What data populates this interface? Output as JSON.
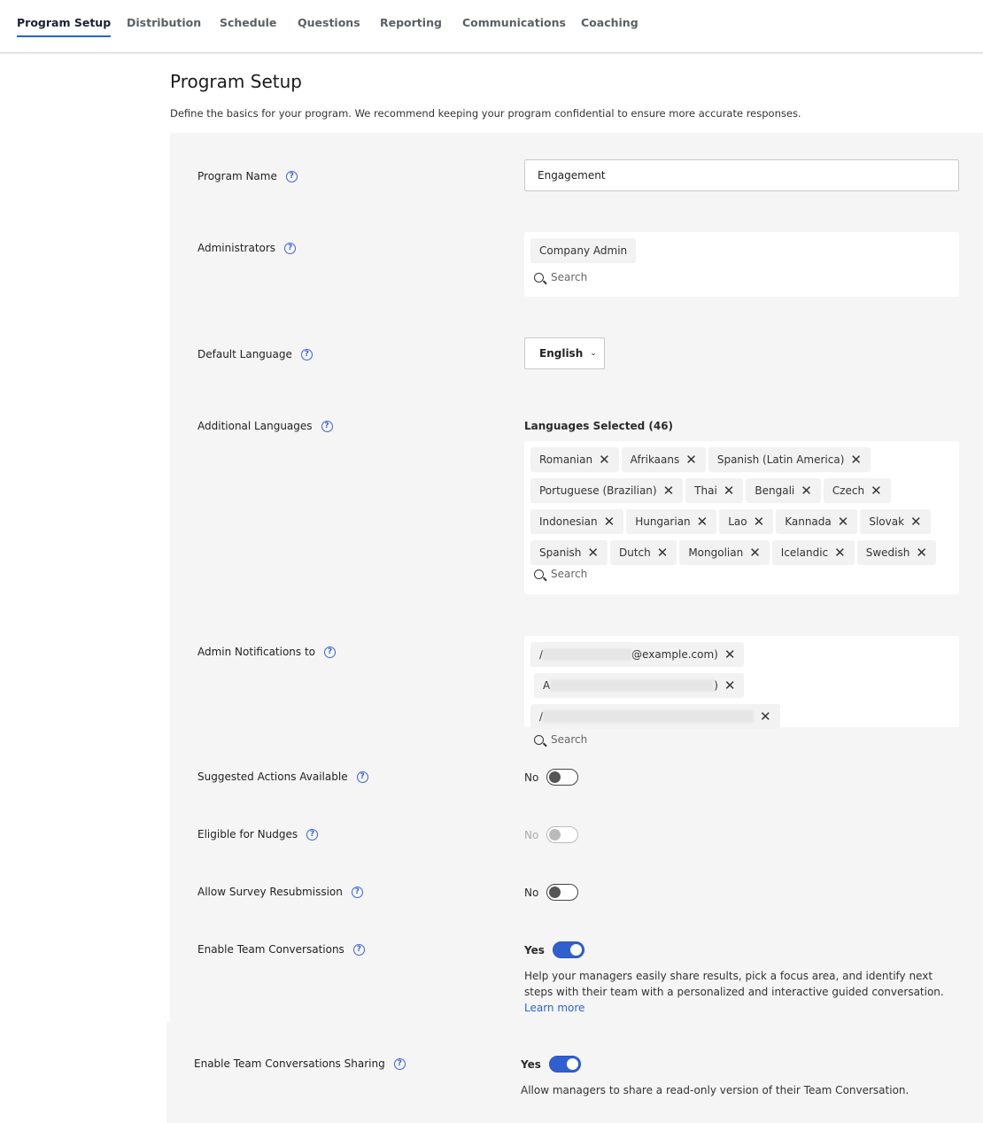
{
  "tabs": [
    {
      "label": "Program Setup",
      "active": true
    },
    {
      "label": "Distribution"
    },
    {
      "label": "Schedule"
    },
    {
      "label": "Questions"
    },
    {
      "label": "Reporting"
    },
    {
      "label": "Communications"
    },
    {
      "label": "Coaching"
    }
  ],
  "page": {
    "title": "Program Setup",
    "description": "Define the basics for your program. We recommend keeping your program confidential to ensure more accurate responses."
  },
  "fields": {
    "program_name": {
      "label": "Program Name",
      "value": "Engagement"
    },
    "administrators": {
      "label": "Administrators",
      "chips": [
        "Company Admin"
      ],
      "search_placeholder": "Search"
    },
    "default_language": {
      "label": "Default Language",
      "value": "English"
    },
    "additional_languages": {
      "label": "Additional Languages",
      "selected_label": "Languages Selected (46)",
      "chips": [
        "Romanian",
        "Afrikaans",
        "Spanish (Latin America)",
        "Portuguese (Brazilian)",
        "Thai",
        "Bengali",
        "Czech",
        "Indonesian",
        "Hungarian",
        "Lao",
        "Kannada",
        "Slovak",
        "Spanish",
        "Dutch",
        "Mongolian",
        "Icelandic",
        "Swedish"
      ],
      "search_placeholder": "Search"
    },
    "admin_notifications": {
      "label": "Admin Notifications to",
      "chips": [
        {
          "prefix": "/",
          "suffix": "@example.com)"
        },
        {
          "prefix": "A",
          "suffix": ")"
        },
        {
          "prefix": "/",
          "suffix": ""
        }
      ],
      "search_placeholder": "Search"
    },
    "suggested_actions": {
      "label": "Suggested Actions Available",
      "state": "No",
      "on": false,
      "disabled": false
    },
    "nudges": {
      "label": "Eligible for Nudges",
      "state": "No",
      "on": false,
      "disabled": true
    },
    "resubmission": {
      "label": "Allow Survey Resubmission",
      "state": "No",
      "on": false,
      "disabled": false
    },
    "team_conversations": {
      "label": "Enable Team Conversations",
      "state": "Yes",
      "on": true,
      "help": "Help your managers easily share results, pick a focus area, and identify next steps with their team with a personalized and interactive guided conversation.",
      "link": "Learn more"
    },
    "team_sharing": {
      "label": "Enable Team Conversations Sharing",
      "state": "Yes",
      "on": true,
      "help": "Allow managers to share a read-only version of their Team Conversation."
    }
  },
  "colors": {
    "accent": "#3060d0",
    "panel": "#f5f5f5",
    "link": "#2f62d2"
  }
}
